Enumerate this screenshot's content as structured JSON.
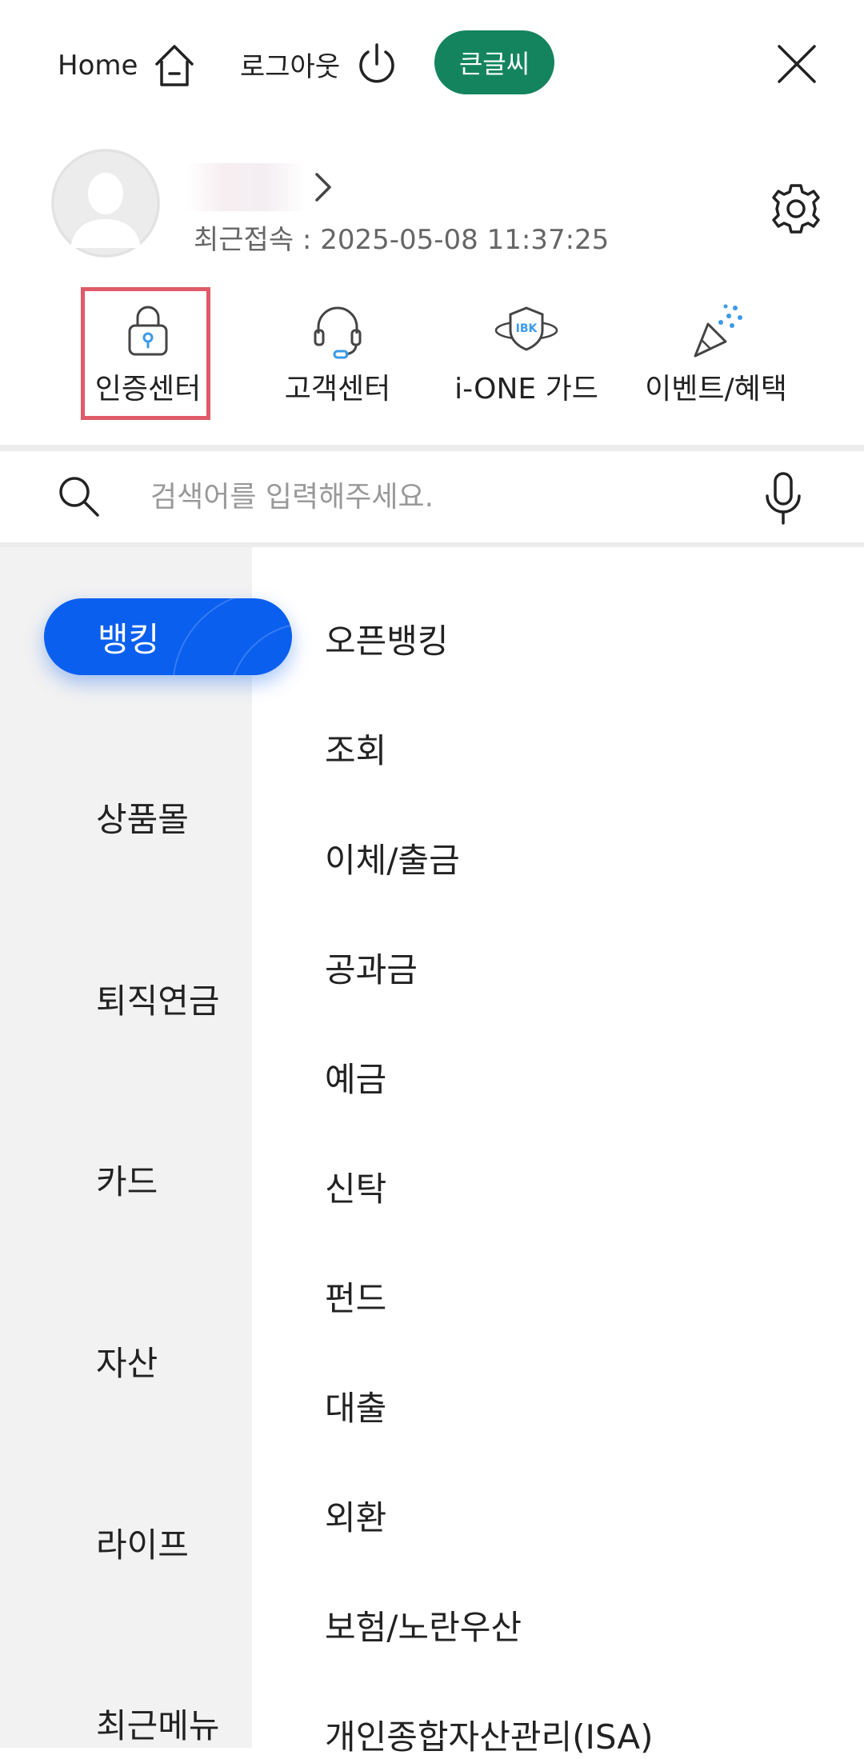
{
  "header": {
    "home_label": "Home",
    "logout_label": "로그아웃",
    "big_font_label": "큰글씨",
    "accent_green": "#14845e"
  },
  "profile": {
    "last_login": "최근접속 : 2025-05-08 11:37:25"
  },
  "quick_menu": [
    {
      "label": "인증센터",
      "icon": "lock-icon"
    },
    {
      "label": "고객센터",
      "icon": "headset-icon"
    },
    {
      "label": "i-ONE 가드",
      "icon": "ibk-shield-icon",
      "badge": "IBK"
    },
    {
      "label": "이벤트/혜택",
      "icon": "party-popper-icon"
    }
  ],
  "search": {
    "placeholder": "검색어를 입력해주세요."
  },
  "categories": [
    {
      "label": "뱅킹",
      "active": true
    },
    {
      "label": "상품몰"
    },
    {
      "label": "퇴직연금"
    },
    {
      "label": "카드"
    },
    {
      "label": "자산"
    },
    {
      "label": "라이프"
    },
    {
      "label": "최근메뉴"
    }
  ],
  "submenu": [
    "오픈뱅킹",
    "조회",
    "이체/출금",
    "공과금",
    "예금",
    "신탁",
    "펀드",
    "대출",
    "외환",
    "보험/노란우산",
    "개인종합자산관리(ISA)"
  ],
  "colors": {
    "primary_blue": "#0a5fef",
    "highlight_red": "#e05a68",
    "icon_blue": "#3a9ae8"
  }
}
